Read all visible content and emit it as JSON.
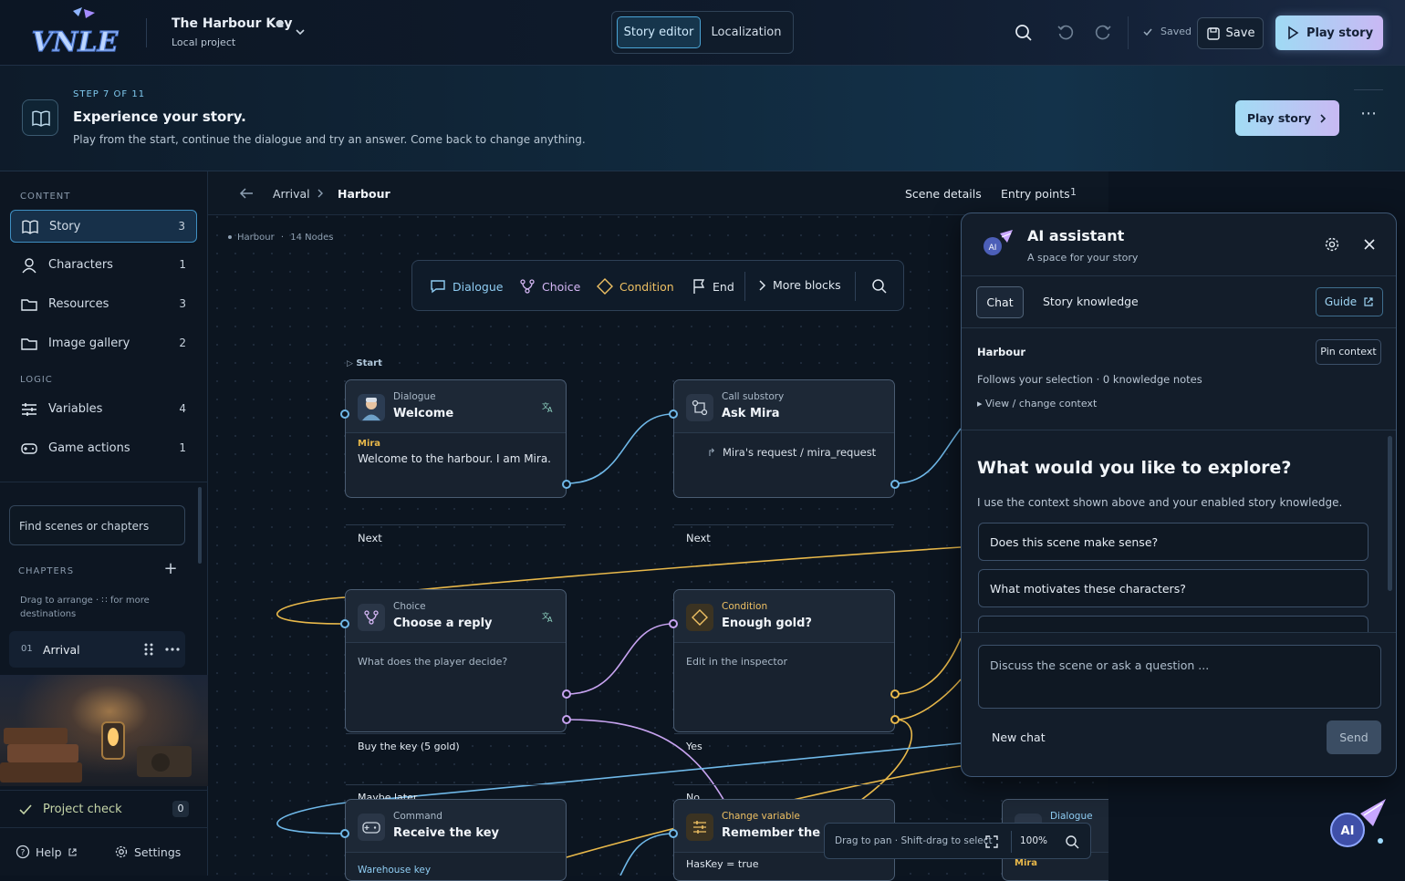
{
  "topbar": {
    "logo_text": "VNLE",
    "project_title": "The Harbour Key",
    "project_sub": "Local project",
    "mode_tabs": [
      "Story editor",
      "Localization"
    ],
    "saved_label": "Saved",
    "save_label": "Save",
    "play_label": "Play story"
  },
  "banner": {
    "step": "STEP 7 OF 11",
    "title": "Experience your story.",
    "description": "Play from the start, continue the dialogue and try an answer. Come back to change anything.",
    "play_label": "Play story",
    "more": "⋯"
  },
  "sidebar": {
    "content_label": "CONTENT",
    "content_items": [
      {
        "label": "Story",
        "count": "3",
        "icon": "book-icon"
      },
      {
        "label": "Characters",
        "count": "1",
        "icon": "person-icon"
      },
      {
        "label": "Resources",
        "count": "3",
        "icon": "folder-icon"
      },
      {
        "label": "Image gallery",
        "count": "2",
        "icon": "folder-icon"
      }
    ],
    "logic_label": "LOGIC",
    "logic_items": [
      {
        "label": "Variables",
        "count": "4",
        "icon": "sliders-icon"
      },
      {
        "label": "Game actions",
        "count": "1",
        "icon": "gamepad-icon"
      }
    ],
    "search_placeholder": "Find scenes or chapters",
    "chapters_label": "CHAPTERS",
    "chapters_hint": "Drag to arrange · ∷ for more destinations",
    "chapter": {
      "num": "01",
      "name": "Arrival"
    },
    "project_check": "Project check",
    "project_check_count": "0",
    "help": "Help",
    "settings": "Settings"
  },
  "breadcrumb": {
    "parent": "Arrival",
    "current": "Harbour",
    "scene_details": "Scene details",
    "entry_points": "Entry points",
    "entry_count": "1"
  },
  "canvas": {
    "scene": "Harbour",
    "nodes_count": "14 Nodes",
    "start_label": "Start",
    "toolbar": [
      "Dialogue",
      "Choice",
      "Condition",
      "End",
      "More blocks"
    ],
    "nodes": {
      "welcome": {
        "type": "Dialogue",
        "title": "Welcome",
        "speaker": "Mira",
        "text": "Welcome to the harbour. I am Mira.",
        "out": "Next"
      },
      "ask": {
        "type": "Call substory",
        "title": "Ask Mira",
        "ref": "Mira's request / mira_request",
        "out": "Next"
      },
      "choice": {
        "type": "Choice",
        "title": "Choose a reply",
        "prompt": "What does the player decide?",
        "options": [
          "Buy the key (5 gold)",
          "Maybe later"
        ]
      },
      "cond": {
        "type": "Condition",
        "title": "Enough gold?",
        "hint": "Edit in the inspector",
        "options": [
          "Yes",
          "No"
        ]
      },
      "command": {
        "type": "Command",
        "title": "Receive the key",
        "line": "Warehouse key"
      },
      "change": {
        "type": "Change variable",
        "title": "Remember the key",
        "line": "HasKey = true"
      },
      "dialogue2": {
        "type": "Dialogue",
        "speaker": "Mira"
      }
    },
    "zoom_hint": "Drag to pan · Shift-drag to select",
    "zoom": "100%"
  },
  "ai": {
    "title": "AI assistant",
    "subtitle": "A space for your story",
    "tabs": [
      "Chat",
      "Story knowledge"
    ],
    "guide": "Guide",
    "context_title": "Harbour",
    "pin": "Pin context",
    "context_desc": "Follows your selection · 0 knowledge notes",
    "context_toggle": "▸ View / change context",
    "question": "What would you like to explore?",
    "intro": "I use the context shown above and your enabled story knowledge.",
    "suggestions": [
      "Does this scene make sense?",
      "What motivates these characters?"
    ],
    "input_placeholder": "Discuss the scene or ask a question ...",
    "new_chat": "New chat",
    "send": "Send"
  },
  "colors": {
    "accent": "#4aa4d6",
    "gold": "#e8b84a",
    "choice": "#c7a3f0",
    "dialogue": "#6fb8e8"
  }
}
